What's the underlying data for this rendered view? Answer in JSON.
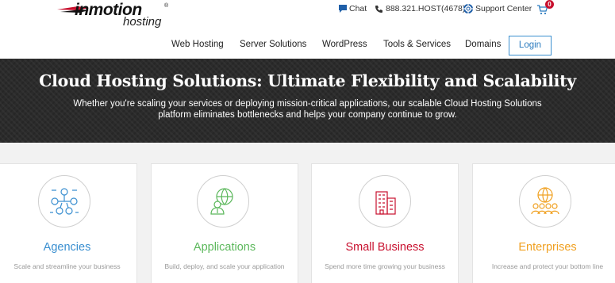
{
  "header": {
    "logo_main": "inmotion",
    "logo_reg": "®",
    "logo_sub": "hosting",
    "chat_label": "Chat",
    "phone_label": "888.321.HOST(4678)",
    "support_label": "Support Center",
    "cart_count": "0",
    "nav": {
      "web_hosting": "Web Hosting",
      "server_solutions": "Server Solutions",
      "wordpress": "WordPress",
      "tools_services": "Tools & Services",
      "domains": "Domains"
    },
    "login_label": "Login"
  },
  "hero": {
    "title": "Cloud Hosting Solutions: Ultimate Flexibility and Scalability",
    "subtitle": "Whether you're scaling your services or deploying mission-critical applications, our scalable Cloud Hosting Solutions platform eliminates bottlenecks and helps your company continue to grow."
  },
  "cards": [
    {
      "title": "Agencies",
      "desc": "Scale and streamline your business",
      "color": "#3a8fd0",
      "icon": "agency-network-icon"
    },
    {
      "title": "Applications",
      "desc": "Build, deploy, and scale your application",
      "color": "#5cb85c",
      "icon": "globe-user-icon"
    },
    {
      "title": "Small Business",
      "desc": "Spend more time growing your business",
      "color": "#c8102e",
      "icon": "building-icon"
    },
    {
      "title": "Enterprises",
      "desc": "Increase and protect your bottom line",
      "color": "#f0a020",
      "icon": "enterprise-team-icon"
    }
  ]
}
